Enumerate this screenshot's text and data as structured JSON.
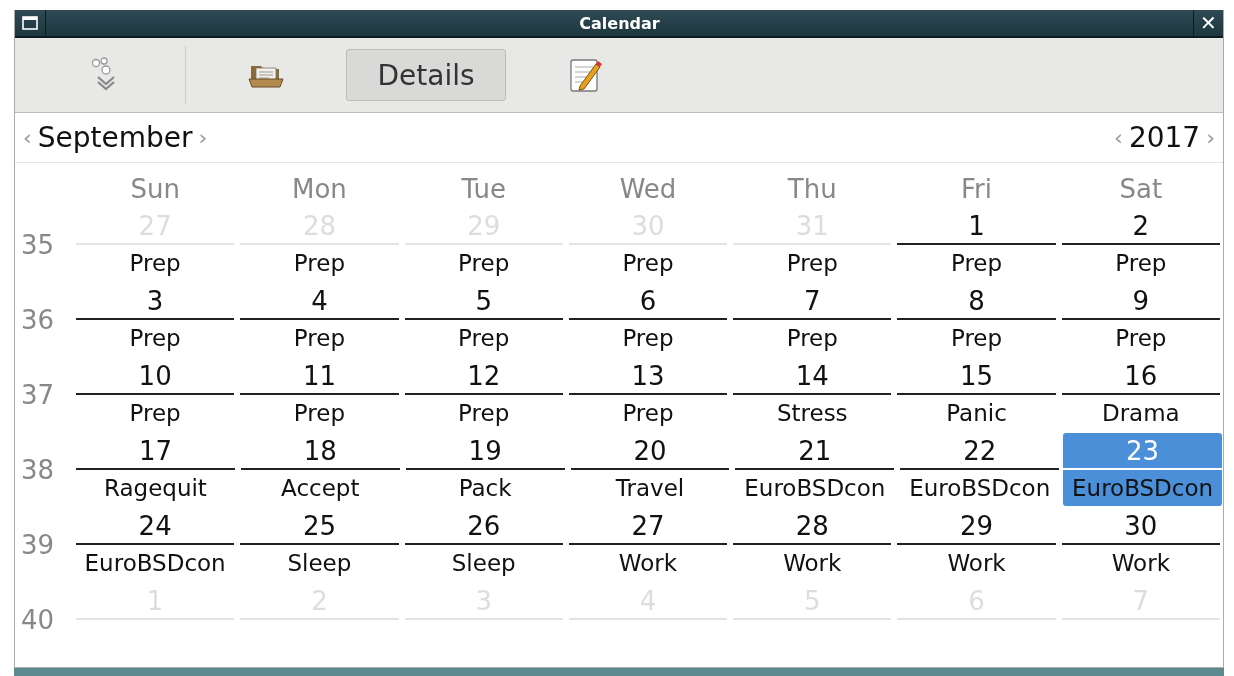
{
  "window": {
    "title": "Calendar",
    "close_button": "✕"
  },
  "toolbar": [
    {
      "kind": "dots-icon"
    },
    {
      "kind": "separator"
    },
    {
      "kind": "folder-icon"
    },
    {
      "kind": "text",
      "label": "Details",
      "pressed": true
    },
    {
      "kind": "notepad-icon"
    }
  ],
  "nav": {
    "month": {
      "prev": "‹",
      "label": "September",
      "next": "›"
    },
    "year": {
      "prev": "‹",
      "label": "2017",
      "next": "›"
    }
  },
  "weekdays": [
    "Sun",
    "Mon",
    "Tue",
    "Wed",
    "Thu",
    "Fri",
    "Sat"
  ],
  "weeks": [
    {
      "number": "35",
      "days": [
        {
          "date": "27",
          "muted": true,
          "selected": false,
          "event": "Prep"
        },
        {
          "date": "28",
          "muted": true,
          "selected": false,
          "event": "Prep"
        },
        {
          "date": "29",
          "muted": true,
          "selected": false,
          "event": "Prep"
        },
        {
          "date": "30",
          "muted": true,
          "selected": false,
          "event": "Prep"
        },
        {
          "date": "31",
          "muted": true,
          "selected": false,
          "event": "Prep"
        },
        {
          "date": "1",
          "muted": false,
          "selected": false,
          "event": "Prep"
        },
        {
          "date": "2",
          "muted": false,
          "selected": false,
          "event": "Prep"
        }
      ]
    },
    {
      "number": "36",
      "days": [
        {
          "date": "3",
          "muted": false,
          "selected": false,
          "event": "Prep"
        },
        {
          "date": "4",
          "muted": false,
          "selected": false,
          "event": "Prep"
        },
        {
          "date": "5",
          "muted": false,
          "selected": false,
          "event": "Prep"
        },
        {
          "date": "6",
          "muted": false,
          "selected": false,
          "event": "Prep"
        },
        {
          "date": "7",
          "muted": false,
          "selected": false,
          "event": "Prep"
        },
        {
          "date": "8",
          "muted": false,
          "selected": false,
          "event": "Prep"
        },
        {
          "date": "9",
          "muted": false,
          "selected": false,
          "event": "Prep"
        }
      ]
    },
    {
      "number": "37",
      "days": [
        {
          "date": "10",
          "muted": false,
          "selected": false,
          "event": "Prep"
        },
        {
          "date": "11",
          "muted": false,
          "selected": false,
          "event": "Prep"
        },
        {
          "date": "12",
          "muted": false,
          "selected": false,
          "event": "Prep"
        },
        {
          "date": "13",
          "muted": false,
          "selected": false,
          "event": "Prep"
        },
        {
          "date": "14",
          "muted": false,
          "selected": false,
          "event": "Stress"
        },
        {
          "date": "15",
          "muted": false,
          "selected": false,
          "event": "Panic"
        },
        {
          "date": "16",
          "muted": false,
          "selected": false,
          "event": "Drama"
        }
      ]
    },
    {
      "number": "38",
      "days": [
        {
          "date": "17",
          "muted": false,
          "selected": false,
          "event": "Ragequit"
        },
        {
          "date": "18",
          "muted": false,
          "selected": false,
          "event": "Accept"
        },
        {
          "date": "19",
          "muted": false,
          "selected": false,
          "event": "Pack"
        },
        {
          "date": "20",
          "muted": false,
          "selected": false,
          "event": "Travel"
        },
        {
          "date": "21",
          "muted": false,
          "selected": false,
          "event": "EuroBSDcon"
        },
        {
          "date": "22",
          "muted": false,
          "selected": false,
          "event": "EuroBSDcon"
        },
        {
          "date": "23",
          "muted": false,
          "selected": true,
          "event": "EuroBSDcon"
        }
      ]
    },
    {
      "number": "39",
      "days": [
        {
          "date": "24",
          "muted": false,
          "selected": false,
          "event": "EuroBSDcon"
        },
        {
          "date": "25",
          "muted": false,
          "selected": false,
          "event": "Sleep"
        },
        {
          "date": "26",
          "muted": false,
          "selected": false,
          "event": "Sleep"
        },
        {
          "date": "27",
          "muted": false,
          "selected": false,
          "event": "Work"
        },
        {
          "date": "28",
          "muted": false,
          "selected": false,
          "event": "Work"
        },
        {
          "date": "29",
          "muted": false,
          "selected": false,
          "event": "Work"
        },
        {
          "date": "30",
          "muted": false,
          "selected": false,
          "event": "Work"
        }
      ]
    },
    {
      "number": "40",
      "days": [
        {
          "date": "1",
          "muted": true,
          "selected": false
        },
        {
          "date": "2",
          "muted": true,
          "selected": false
        },
        {
          "date": "3",
          "muted": true,
          "selected": false
        },
        {
          "date": "4",
          "muted": true,
          "selected": false
        },
        {
          "date": "5",
          "muted": true,
          "selected": false
        },
        {
          "date": "6",
          "muted": true,
          "selected": false
        },
        {
          "date": "7",
          "muted": true,
          "selected": false
        }
      ]
    }
  ]
}
